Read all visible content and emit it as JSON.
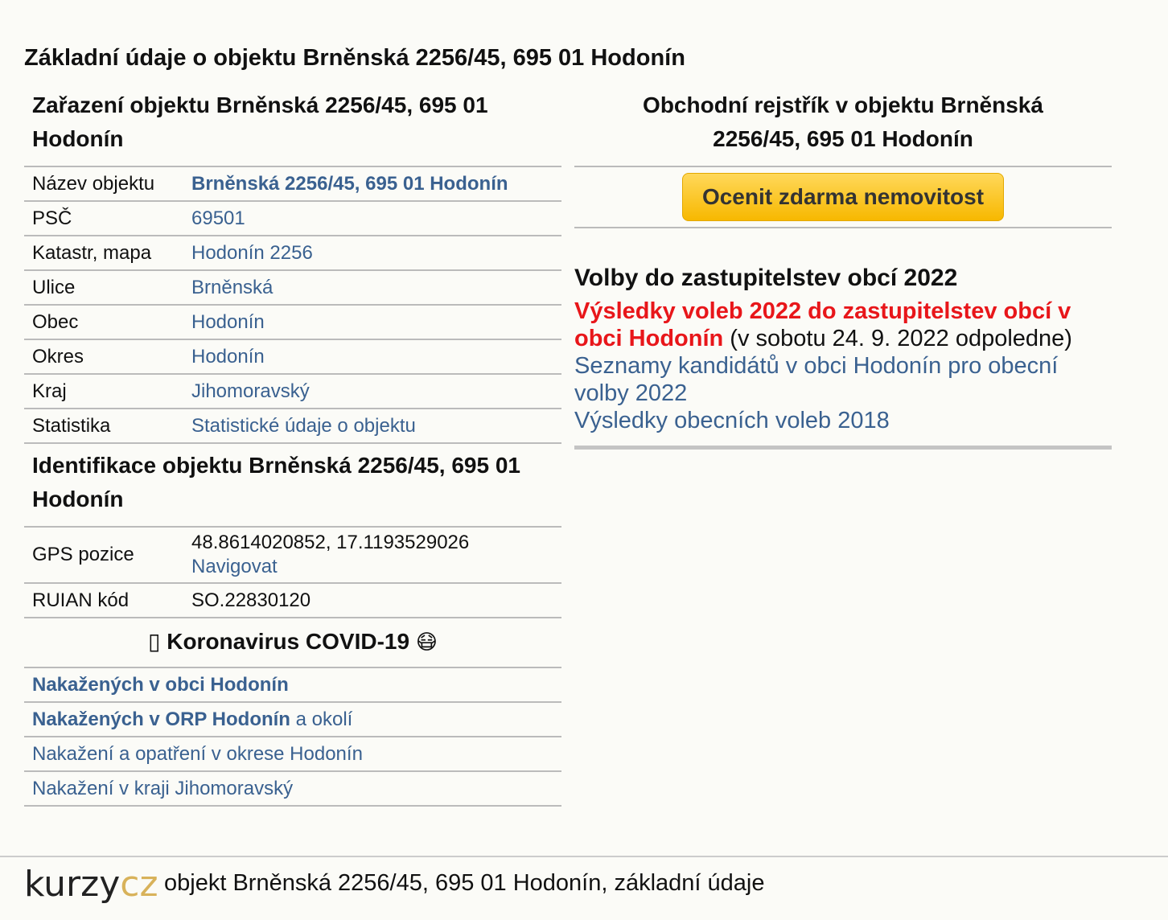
{
  "page_title": "Základní údaje o objektu Brněnská 2256/45, 695 01 Hodonín",
  "classification": {
    "title": "Zařazení objektu Brněnská 2256/45, 695 01 Hodonín",
    "rows": [
      {
        "label": "Název objektu",
        "value": "Brněnská 2256/45, 695 01 Hodonín"
      },
      {
        "label": "PSČ",
        "value": "69501"
      },
      {
        "label": "Katastr, mapa",
        "value": "Hodonín 2256"
      },
      {
        "label": "Ulice",
        "value": "Brněnská"
      },
      {
        "label": "Obec",
        "value": "Hodonín"
      },
      {
        "label": "Okres",
        "value": "Hodonín"
      },
      {
        "label": "Kraj",
        "value": "Jihomoravský"
      },
      {
        "label": "Statistika",
        "value": "Statistické údaje o objektu"
      }
    ]
  },
  "identification": {
    "title": "Identifikace objektu Brněnská 2256/45, 695 01 Hodonín",
    "gps_label": "GPS pozice",
    "gps_value": "48.8614020852, 17.1193529026",
    "navigate_link": "Navigovat",
    "ruian_label": "RUIAN kód",
    "ruian_value": "SO.22830120"
  },
  "covid": {
    "box_glyph": "▯",
    "title": "Koronavirus COVID-19",
    "mask_glyph": "😷",
    "links": [
      {
        "text": "Nakažených v obci Hodonín",
        "suffix": ""
      },
      {
        "text": "Nakažených v ORP Hodonín",
        "suffix": " a okolí"
      },
      {
        "text": "Nakažení a opatření v okrese Hodonín",
        "suffix": ""
      },
      {
        "text": "Nakažení v kraji Jihomoravský",
        "suffix": ""
      }
    ]
  },
  "business_register": {
    "title": "Obchodní rejstřík v objektu Brněnská 2256/45, 695 01 Hodonín",
    "button_label": "Ocenit zdarma nemovitost"
  },
  "elections": {
    "title": "Volby do zastupitelstev obcí 2022",
    "results_link": "Výsledky voleb 2022 do zastupitelstev obcí v obci Hodonín",
    "results_note": " (v sobotu 24. 9. 2022 odpoledne)",
    "candidates_link": "Seznamy kandidátů v obci Hodonín pro obecní volby 2022",
    "results_2018_link": "Výsledky obecních voleb 2018"
  },
  "footer": {
    "logo_kurzy": "kurzy",
    "logo_cz": "cz",
    "text": "objekt Brněnská 2256/45, 695 01 Hodonín, základní údaje"
  },
  "colors": {
    "link": "#3a6190",
    "red_link": "#e8161a",
    "button": "#f7b800",
    "background": "#fbfbf7"
  }
}
